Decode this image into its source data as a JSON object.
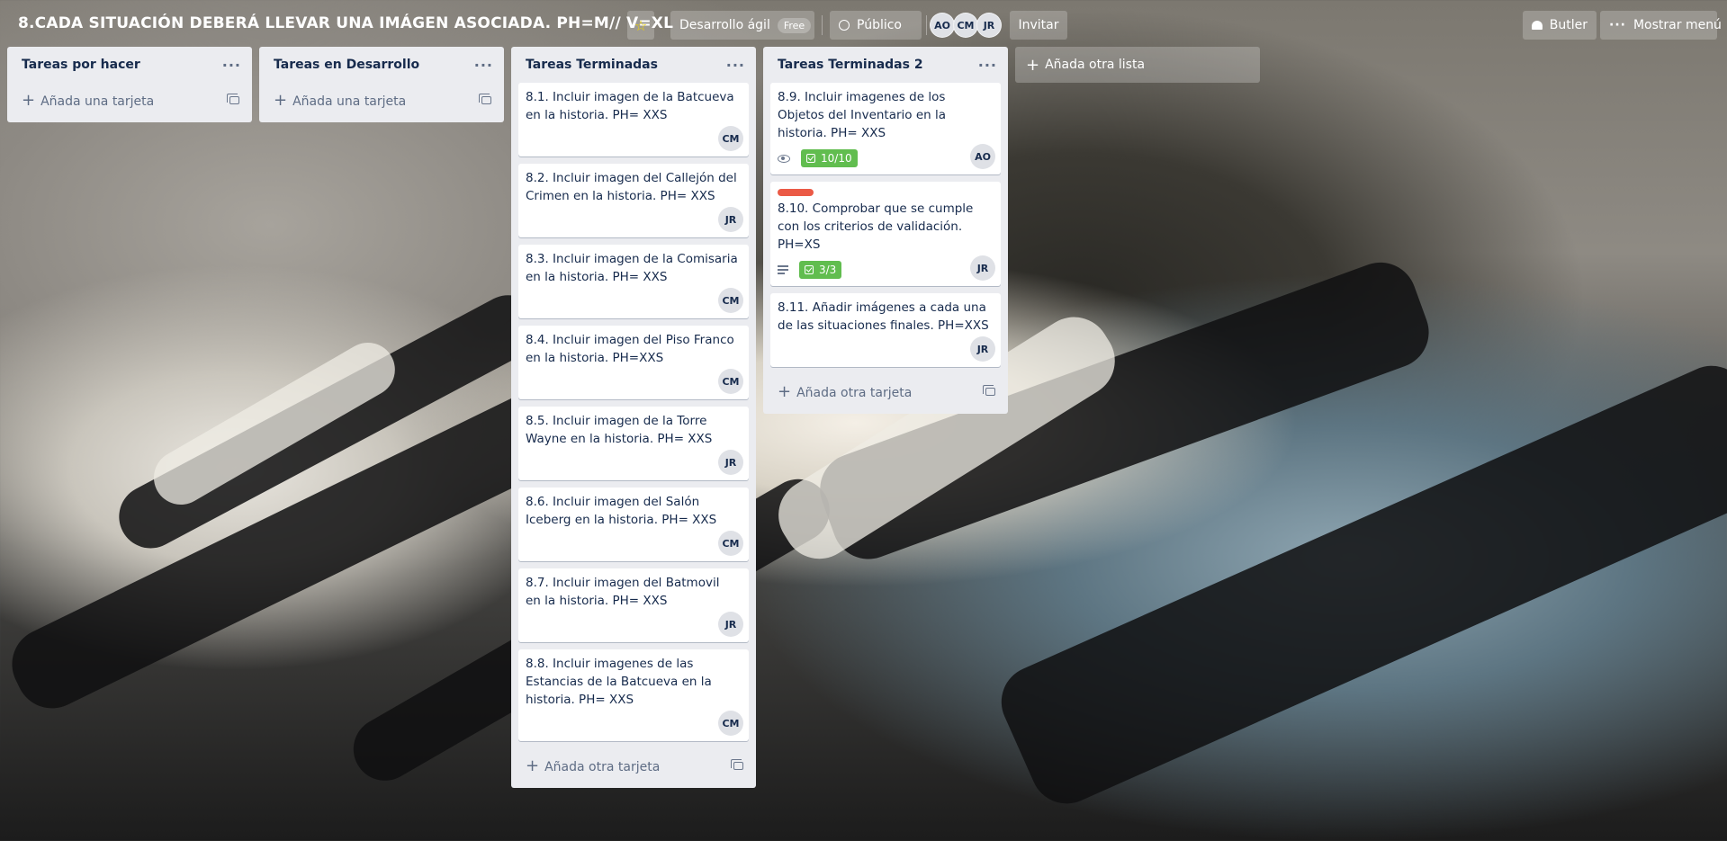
{
  "board": {
    "title": "8.CADA SITUACIÓN DEBERÁ LLEVAR UNA IMÁGEN ASOCIADA. PH=M// V=XL",
    "team_label": "Desarrollo ágil",
    "team_badge": "Free",
    "visibility_label": "Público",
    "members": [
      "AO",
      "CM",
      "JR"
    ],
    "invite_label": "Invitar",
    "butler_label": "Butler",
    "menu_label": "Mostrar menú",
    "add_list_label": "Añada otra lista",
    "colors": {
      "star": "#f2d600",
      "label_red": "#eb5a46",
      "checklist_complete": "#61bd4f"
    }
  },
  "lists": [
    {
      "title": "Tareas por hacer",
      "menu": "···",
      "add_label": "Añada una tarjeta",
      "cards": []
    },
    {
      "title": "Tareas en Desarrollo",
      "menu": "···",
      "add_label": "Añada una tarjeta",
      "cards": []
    },
    {
      "title": "Tareas Terminadas",
      "menu": "···",
      "add_label": "Añada otra tarjeta",
      "cards": [
        {
          "text": "8.1. Incluir imagen de la Batcueva en la historia. PH= XXS",
          "member": "CM"
        },
        {
          "text": "8.2. Incluir imagen del Callejón del Crimen en la historia. PH= XXS",
          "member": "JR"
        },
        {
          "text": "8.3. Incluir imagen de la Comisaria en la historia. PH= XXS",
          "member": "CM"
        },
        {
          "text": "8.4. Incluir imagen del Piso Franco en la historia. PH=XXS",
          "member": "CM"
        },
        {
          "text": "8.5. Incluir imagen de la Torre Wayne en la historia. PH= XXS",
          "member": "JR"
        },
        {
          "text": "8.6. Incluir imagen del Salón Iceberg en la historia. PH= XXS",
          "member": "CM"
        },
        {
          "text": "8.7. Incluir imagen del Batmovil en la historia. PH= XXS",
          "member": "JR"
        },
        {
          "text": "8.8. Incluir imagenes de las Estancias de la Batcueva en la historia. PH= XXS",
          "member": "CM"
        }
      ]
    },
    {
      "title": "Tareas Terminadas 2",
      "menu": "···",
      "add_label": "Añada otra tarjeta",
      "cards": [
        {
          "text": "8.9. Incluir imagenes de los Objetos del Inventario en la historia. PH= XXS",
          "member": "AO",
          "checklist": "10/10",
          "watching": true
        },
        {
          "text": "8.10. Comprobar que se cumple con los criterios de validación. PH=XS",
          "member": "JR",
          "checklist": "3/3",
          "label": "red",
          "description": true
        },
        {
          "text": "8.11. Añadir imágenes a cada una de las situaciones finales. PH=XXS",
          "member": "JR"
        }
      ]
    }
  ]
}
